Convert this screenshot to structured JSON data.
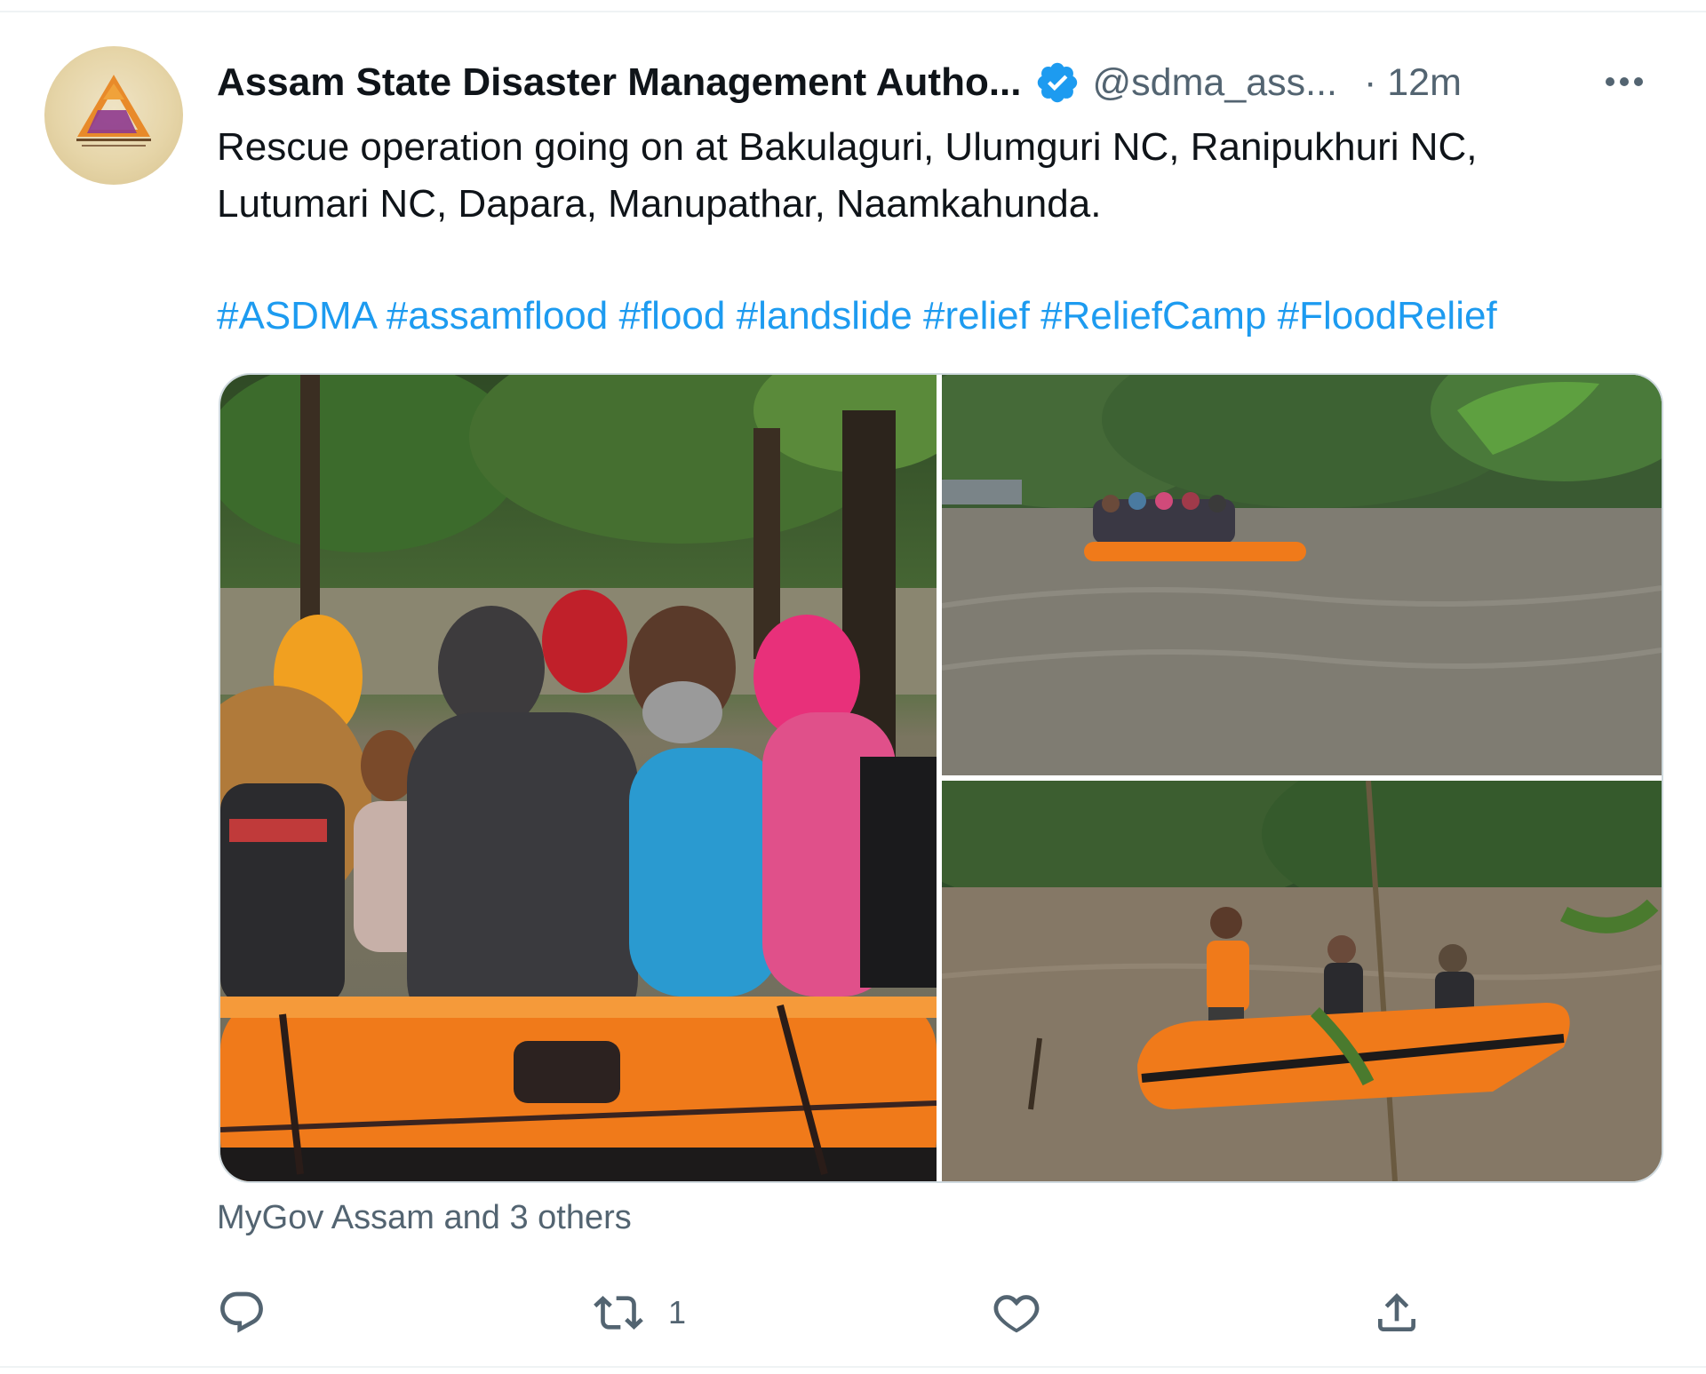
{
  "tweet": {
    "author": {
      "display_name": "Assam State Disaster Management Autho...",
      "handle": "@sdma_ass...",
      "verified": true,
      "timestamp": "· 12m",
      "avatar_icon": "asdma-logo"
    },
    "text_lines": [
      "Rescue operation going on at Bakulaguri, Ulumguri NC, Ranipukhuri NC,",
      "Lutumari NC, Dapara, Manupathar, Naamkahunda."
    ],
    "hashtags": [
      "#ASDMA",
      "#assamflood",
      "#flood",
      "#landslide",
      "#relief",
      "#ReliefCamp",
      "#FloodRelief"
    ],
    "media": [
      {
        "icon": "photo-flood-rescue-boat-closeup"
      },
      {
        "icon": "photo-boat-on-floodwater"
      },
      {
        "icon": "photo-rescuers-in-boat"
      }
    ],
    "tagged_users": "MyGov Assam and 3 others",
    "actions": {
      "reply_count": "",
      "retweet_count": "1",
      "like_count": "",
      "share_icon": "share-icon"
    }
  },
  "colors": {
    "text_primary": "#0f1419",
    "text_secondary": "#536471",
    "accent": "#1d9bf0",
    "border": "#cfd9de"
  }
}
